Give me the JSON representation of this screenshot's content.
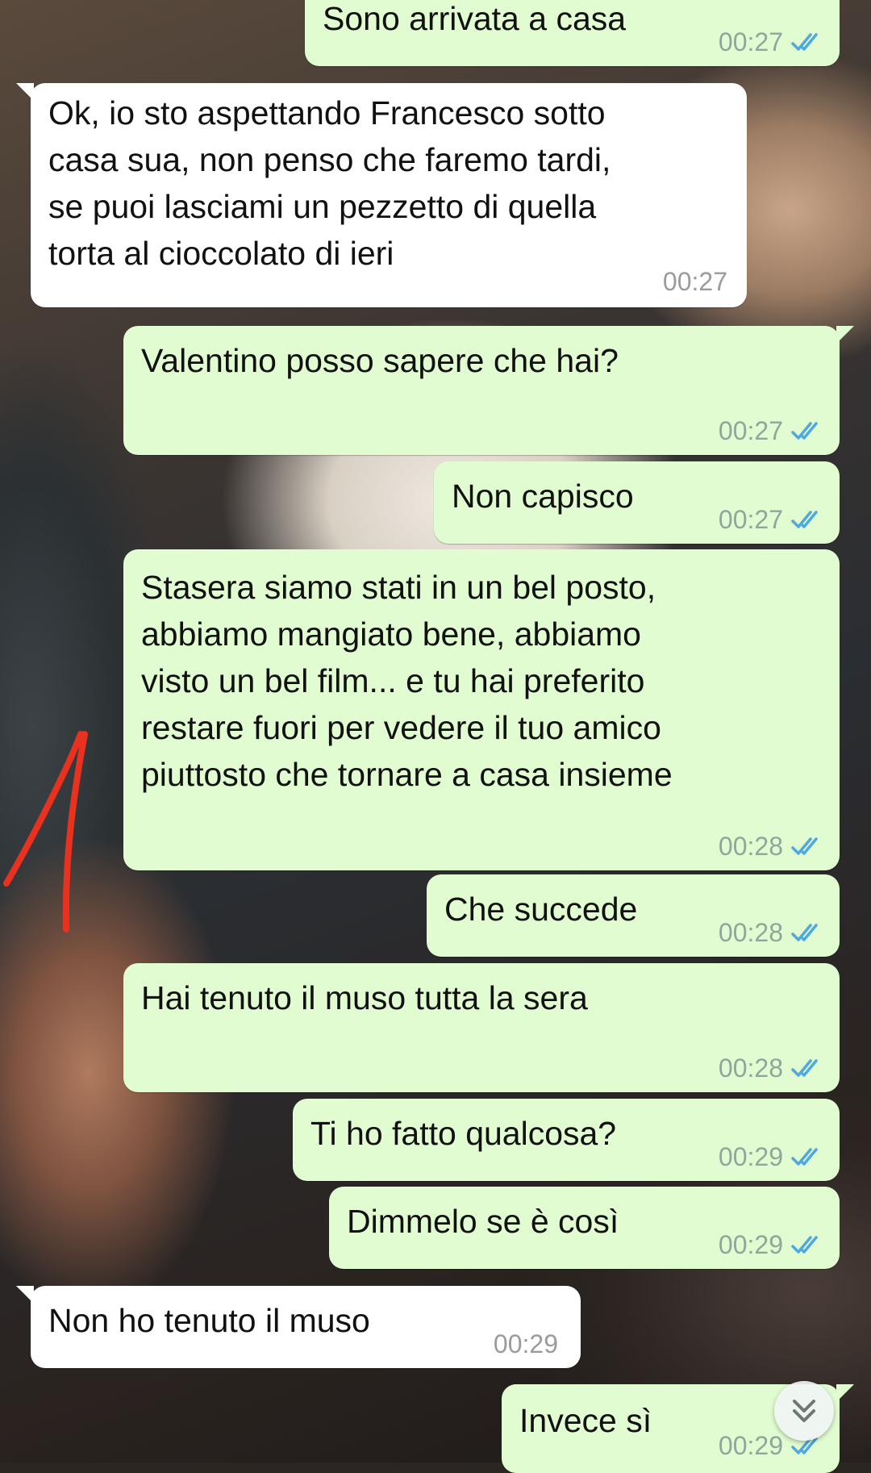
{
  "messages": [
    {
      "direction": "out",
      "text": "Sono arrivata a casa",
      "time": "00:27"
    },
    {
      "direction": "in",
      "text": "Ok, io sto aspettando Francesco sotto\ncasa sua, non penso che faremo tardi,\nse puoi lasciami un pezzetto di quella\ntorta al cioccolato di ieri",
      "time": "00:27"
    },
    {
      "direction": "out",
      "text": "Valentino posso sapere che hai?",
      "time": "00:27"
    },
    {
      "direction": "out",
      "text": "Non capisco",
      "time": "00:27"
    },
    {
      "direction": "out",
      "text": "Stasera siamo stati in un bel posto,\nabbiamo mangiato bene, abbiamo\nvisto un bel film... e tu hai preferito\nrestare fuori per vedere il tuo amico\npiuttosto che tornare a casa insieme",
      "time": "00:28"
    },
    {
      "direction": "out",
      "text": "Che succede",
      "time": "00:28"
    },
    {
      "direction": "out",
      "text": "Hai tenuto il muso tutta la sera",
      "time": "00:28"
    },
    {
      "direction": "out",
      "text": "Ti ho fatto qualcosa?",
      "time": "00:29"
    },
    {
      "direction": "out",
      "text": "Dimmelo se è così",
      "time": "00:29"
    },
    {
      "direction": "in",
      "text": "Non ho tenuto il muso",
      "time": "00:29"
    },
    {
      "direction": "out",
      "text": "Invece sì",
      "time": "00:29"
    }
  ],
  "annotation": {
    "color": "#e8321f"
  },
  "colors": {
    "outgoing_bubble": "#e2fcd1",
    "incoming_bubble": "#ffffff",
    "read_ticks": "#4fa8e0"
  },
  "icons": {
    "read_receipt": "double-check-icon",
    "scroll_down": "chevron-double-down-icon"
  }
}
